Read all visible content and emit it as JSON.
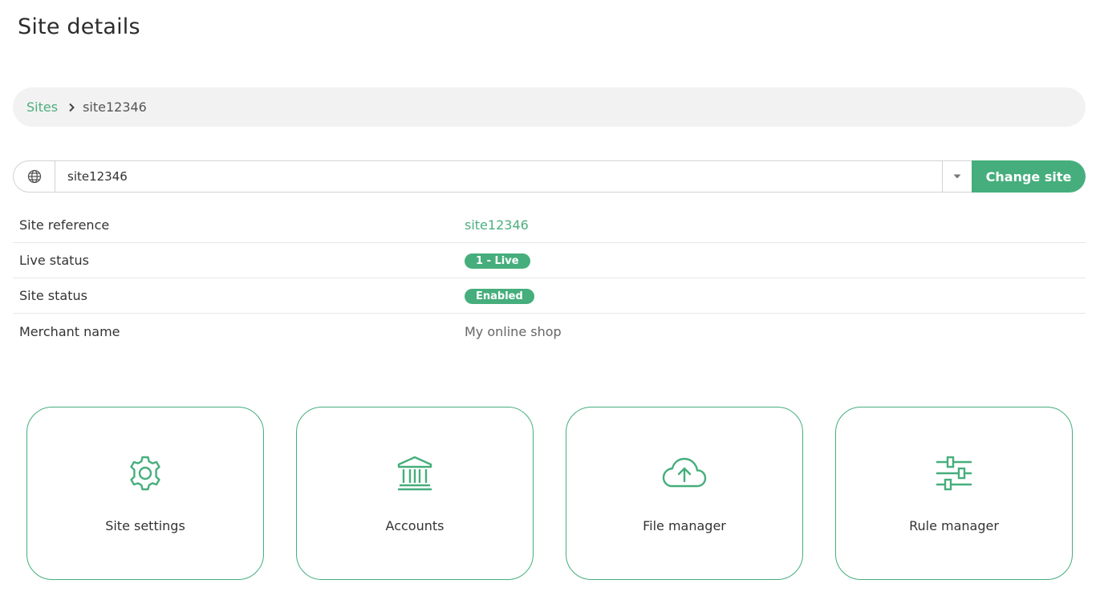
{
  "page": {
    "title": "Site details"
  },
  "breadcrumb": {
    "root": "Sites",
    "current": "site12346"
  },
  "site_picker": {
    "value": "site12346",
    "button_label": "Change site"
  },
  "details": [
    {
      "label": "Site reference",
      "value": "site12346",
      "kind": "link"
    },
    {
      "label": "Live status",
      "value": "1 - Live",
      "kind": "badge"
    },
    {
      "label": "Site status",
      "value": "Enabled",
      "kind": "badge"
    },
    {
      "label": "Merchant name",
      "value": "My online shop",
      "kind": "text"
    }
  ],
  "tiles": [
    {
      "label": "Site settings",
      "icon": "gear-icon"
    },
    {
      "label": "Accounts",
      "icon": "bank-icon"
    },
    {
      "label": "File manager",
      "icon": "cloud-upload-icon"
    },
    {
      "label": "Rule manager",
      "icon": "sliders-icon"
    }
  ],
  "colors": {
    "accent": "#46ae7c",
    "breadcrumb_bg": "#f2f2f2"
  }
}
